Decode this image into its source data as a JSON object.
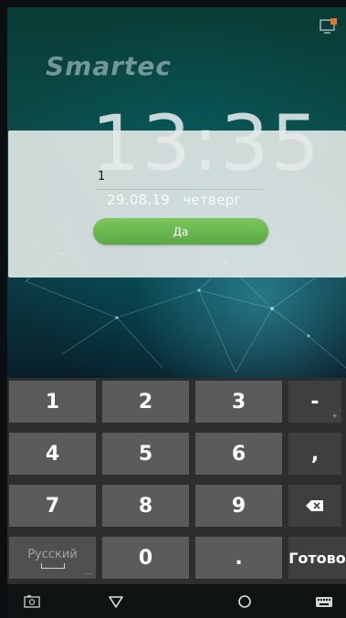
{
  "app": {
    "logo_text": "Smartec",
    "clock": "13:35",
    "date": "29.08.19",
    "weekday": "четверг"
  },
  "dialog": {
    "input_value": "1",
    "confirm_label": "Да"
  },
  "keyboard": {
    "rows": [
      [
        {
          "label": "1"
        },
        {
          "label": "2"
        },
        {
          "label": "3"
        },
        {
          "label": "-",
          "hint": "+"
        }
      ],
      [
        {
          "label": "4"
        },
        {
          "label": "5"
        },
        {
          "label": "6"
        },
        {
          "label": ","
        }
      ],
      [
        {
          "label": "7"
        },
        {
          "label": "8"
        },
        {
          "label": "9"
        },
        {
          "label": "backspace",
          "icon": "backspace-icon"
        }
      ],
      [
        {
          "label": "Русский",
          "hint": "..."
        },
        {
          "label": "0"
        },
        {
          "label": "."
        },
        {
          "label": "Готово"
        }
      ]
    ]
  },
  "navbar": {
    "icons": [
      "screenshot-icon",
      "back-icon",
      "home-icon",
      "keyboard-icon"
    ]
  },
  "colors": {
    "accent_green": "#6bb94f",
    "key_bg": "#5a5b5c",
    "keyboard_bg": "#2c2e2f"
  }
}
